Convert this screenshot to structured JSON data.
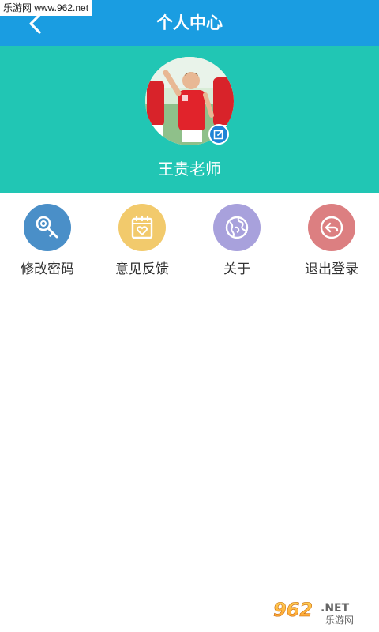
{
  "watermark": {
    "top_text": "乐游网 www.962.net",
    "bottom_logo": "962.NET",
    "bottom_sub": "乐游网"
  },
  "header": {
    "title": "个人中心",
    "back_icon": "chevron-left-icon",
    "background": "#1a9de1"
  },
  "profile": {
    "name": "王贵老师",
    "background": "#21c6b4",
    "edit_icon": "edit-icon"
  },
  "menu": {
    "items": [
      {
        "label": "修改密码",
        "icon": "key-icon",
        "color": "#4a8fc8"
      },
      {
        "label": "意见反馈",
        "icon": "calendar-heart-icon",
        "color": "#f2ca6c"
      },
      {
        "label": "关于",
        "icon": "globe-icon",
        "color": "#a8a1dc"
      },
      {
        "label": "退出登录",
        "icon": "logout-arrow-icon",
        "color": "#dc7f81"
      }
    ]
  }
}
